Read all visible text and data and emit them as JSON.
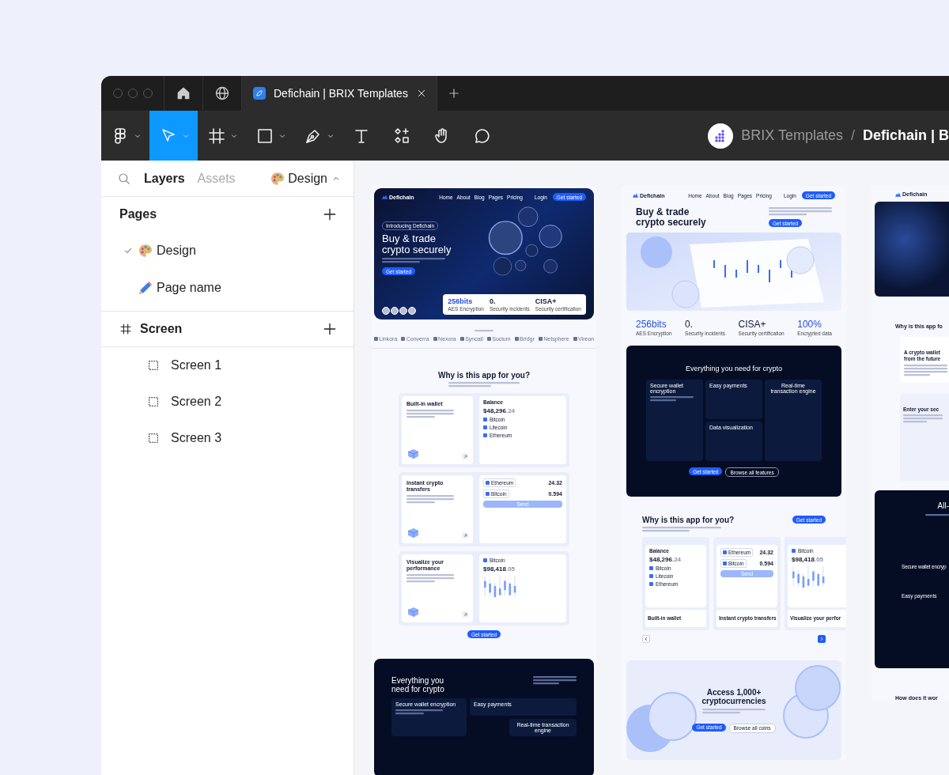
{
  "window": {
    "tabs": [
      {
        "kind": "home",
        "selected": false
      },
      {
        "kind": "globe",
        "selected": false
      },
      {
        "kind": "document",
        "label": "Defichain | BRIX Templates",
        "selected": true
      }
    ]
  },
  "toolbar": {
    "tools": [
      {
        "kind": "main-menu",
        "selected": false,
        "dropdown": true
      },
      {
        "kind": "move",
        "selected": true,
        "dropdown": true
      },
      {
        "kind": "frame",
        "selected": false,
        "dropdown": true
      },
      {
        "kind": "shape",
        "selected": false,
        "dropdown": true
      },
      {
        "kind": "pen",
        "selected": false,
        "dropdown": true
      },
      {
        "kind": "text",
        "selected": false,
        "dropdown": false
      },
      {
        "kind": "components",
        "selected": false,
        "dropdown": false
      },
      {
        "kind": "hand",
        "selected": false,
        "dropdown": false
      },
      {
        "kind": "comment",
        "selected": false,
        "dropdown": false
      }
    ],
    "breadcrumb": {
      "team": "BRIX Templates",
      "separator": "/",
      "file": "Defichain | B"
    }
  },
  "left_panel": {
    "tabs": [
      {
        "label": "Layers",
        "selected": true
      },
      {
        "label": "Assets",
        "selected": false
      }
    ],
    "page_selector": {
      "label": "Design"
    },
    "pages": {
      "title": "Pages",
      "items": [
        {
          "kind": "palette",
          "label": "Design",
          "selected": true
        },
        {
          "kind": "pencil",
          "label": "Page name",
          "selected": false
        }
      ]
    },
    "section": {
      "title": "Screen",
      "layers": [
        {
          "label": "Screen 1"
        },
        {
          "label": "Screen 2"
        },
        {
          "label": "Screen 3"
        }
      ]
    }
  },
  "canvas": {
    "frames": [
      {
        "blocks": [
          {
            "kind": "hero-dark",
            "logo": "Defichain",
            "links": [
              "Home",
              "About",
              "Blog",
              "Pages",
              "Pricing"
            ],
            "login": "Login",
            "cta": "Get started",
            "badge": "Introducing Defichain",
            "title": "Buy & trade crypto securely",
            "button": "Get started",
            "stats": [
              {
                "value": "256bits",
                "label": "AES Encryption",
                "accent": true
              },
              {
                "value": "0.",
                "label": "Security incidents",
                "accent": false
              },
              {
                "value": "CISA+",
                "label": "Security certification",
                "accent": false
              }
            ]
          },
          {
            "kind": "logos",
            "items": [
              "Linkora",
              "Converra",
              "Nexora",
              "Syncall",
              "Socium",
              "Bridgr",
              "Netsphere",
              "Vireon"
            ]
          },
          {
            "kind": "features-stack",
            "title": "Why is this app for you?",
            "button": "Get started",
            "cards": [
              {
                "title": "Built-in wallet",
                "widget": {
                  "kind": "balance",
                  "label": "Balance",
                  "amount": "$48,296",
                  "cents": ".24",
                  "coins": [
                    "Bitcoin",
                    "Litecoin",
                    "Ethereum"
                  ]
                }
              },
              {
                "title": "Instant crypto transfers",
                "widget": {
                  "kind": "transfer",
                  "from_coin": "Ethereum",
                  "from_amount": "24.32",
                  "to_coin": "Bitcoin",
                  "to_amount": "0.594",
                  "button": "Send"
                }
              },
              {
                "title": "Visualize your performance",
                "widget": {
                  "kind": "chart",
                  "coin": "Bitcoin",
                  "amount": "$98,418",
                  "cents": ".05"
                }
              }
            ]
          },
          {
            "kind": "dark-split",
            "title": "Everything you need for crypto",
            "cards": [
              "Secure wallet encryption",
              "Easy payments",
              "Real-time transaction engine"
            ]
          }
        ]
      },
      {
        "blocks": [
          {
            "kind": "nav-light",
            "logo": "Defichain",
            "links": [
              "Home",
              "About",
              "Blog",
              "Pages",
              "Pricing"
            ],
            "login": "Login",
            "cta": "Get started"
          },
          {
            "kind": "hero-light",
            "title": "Buy & trade crypto securely",
            "button": "Get started"
          },
          {
            "kind": "dashboard-image"
          },
          {
            "kind": "stats",
            "items": [
              {
                "value": "256bits",
                "label": "AES Encryption",
                "accent": true
              },
              {
                "value": "0.",
                "label": "Security incidents",
                "accent": false
              },
              {
                "value": "CISA+",
                "label": "Security certification",
                "accent": false
              },
              {
                "value": "100%",
                "label": "Encrypted data",
                "accent": true
              }
            ]
          },
          {
            "kind": "dark-grid",
            "title": "Everything you need for crypto",
            "cards": [
              "Secure wallet encryption",
              "Easy payments",
              "Data visualization",
              "Real-time transaction engine"
            ],
            "buttons": [
              "Get started",
              "Browse all features"
            ]
          },
          {
            "kind": "features-carousel",
            "title": "Why is this app for you?",
            "button": "Get started",
            "cards": [
              {
                "title": "Built-in wallet",
                "widget": {
                  "kind": "balance",
                  "label": "Balance",
                  "amount": "$48,296",
                  "cents": ".24",
                  "coins": [
                    "Bitcoin",
                    "Litecoin",
                    "Ethereum"
                  ]
                }
              },
              {
                "title": "Instant crypto transfers",
                "widget": {
                  "kind": "transfer",
                  "from_coin": "Ethereum",
                  "from_amount": "24.32",
                  "to_coin": "Bitcoin",
                  "to_amount": "0.594",
                  "button": "Send"
                }
              },
              {
                "title": "Visualize your perfor",
                "widget": {
                  "kind": "chart",
                  "coin": "Bitcoin",
                  "amount": "$98,418",
                  "cents": ".05"
                }
              }
            ]
          },
          {
            "kind": "access",
            "title": "Access 1,000+ cryptocurrencies",
            "buttons": [
              "Get started",
              "Browse all coins"
            ]
          }
        ]
      },
      {
        "blocks": [
          {
            "kind": "nav-light",
            "logo": "Defichain"
          },
          {
            "kind": "dark-image"
          },
          {
            "kind": "heading",
            "title": "Why is this app fo"
          },
          {
            "kind": "info-card",
            "title": "A crypto wallet from the future"
          },
          {
            "kind": "pin-card",
            "title": "Enter your sec"
          },
          {
            "kind": "dark-partial",
            "title": "All-",
            "cards": [
              "Secure wallet encryp",
              "Easy payments"
            ]
          },
          {
            "kind": "heading",
            "title": "How does it wor"
          }
        ]
      }
    ]
  }
}
